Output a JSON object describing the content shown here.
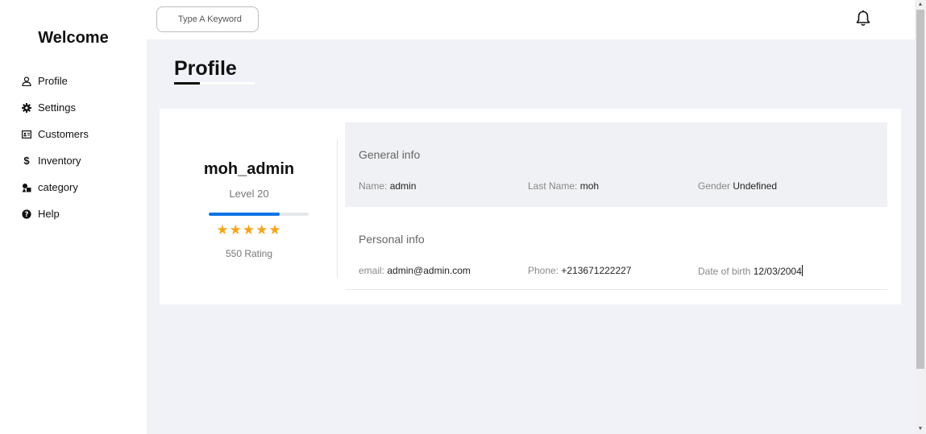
{
  "sidebar": {
    "brand": "Welcome",
    "items": [
      {
        "label": "Profile",
        "icon": "user-icon"
      },
      {
        "label": "Settings",
        "icon": "gear-icon"
      },
      {
        "label": "Customers",
        "icon": "id-card-icon"
      },
      {
        "label": "Inventory",
        "icon": "dollar-icon"
      },
      {
        "label": "category",
        "icon": "shapes-icon"
      },
      {
        "label": "Help",
        "icon": "question-circle-icon"
      }
    ]
  },
  "header": {
    "search_placeholder": "Type A Keyword",
    "notification_icon": "bell-icon"
  },
  "page": {
    "title": "Profile"
  },
  "profile": {
    "username": "moh_admin",
    "level": "Level 20",
    "level_progress": 0.71,
    "stars": 5,
    "stars_text": "★★★★★",
    "rating": "550 Rating"
  },
  "general_info": {
    "title": "General info",
    "name_label": "Name:",
    "name_value": "admin",
    "last_name_label": "Last Name:",
    "last_name_value": "moh",
    "gender_label": "Gender",
    "gender_value": "Undefined"
  },
  "personal_info": {
    "title": "Personal info",
    "email_label": "email:",
    "email_value": "admin@admin.com",
    "phone_label": "Phone:",
    "phone_value": "+213671222227",
    "dob_label": "Date of birth",
    "dob_value": "12/03/2004"
  },
  "colors": {
    "accent": "#0b74e5",
    "star": "#f5a41b",
    "main_bg": "#f0f2f7"
  }
}
